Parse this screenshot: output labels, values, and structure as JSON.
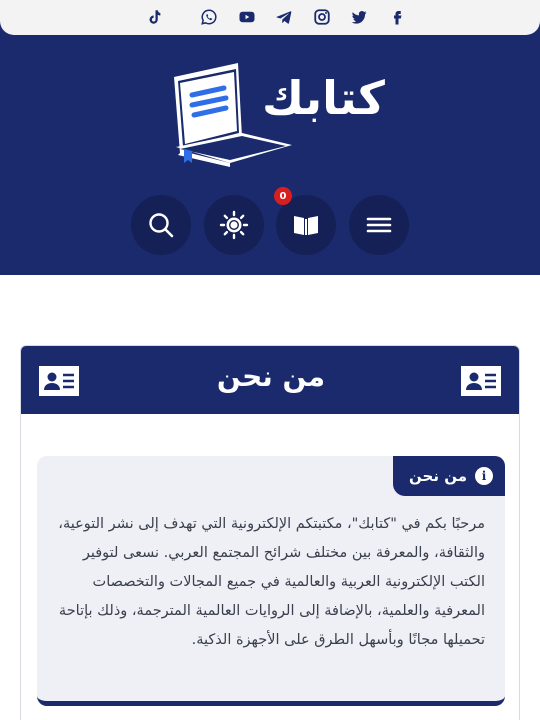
{
  "social": {
    "icons": [
      "facebook-icon",
      "twitter-icon",
      "instagram-icon",
      "telegram-icon",
      "youtube-icon",
      "whatsapp-icon",
      "tiktok-icon"
    ]
  },
  "header": {
    "logo_text": "كتابك",
    "cart_count": "0"
  },
  "page": {
    "title": "من نحن",
    "box_label": "من نحن",
    "info_symbol": "i",
    "body_text": "مرحبًا بكم في \"كتابك\"، مكتبتكم الإلكترونية التي تهدف إلى نشر التوعية، والثقافة، والمعرفة بين مختلف شرائح المجتمع العربي. نسعى لتوفير الكتب الإلكترونية العربية والعالمية في جميع المجالات والتخصصات المعرفية والعلمية، بالإضافة إلى الروايات العالمية المترجمة، وذلك بإتاحة تحميلها مجانًا وبأسهل الطرق على الأجهزة الذكية."
  },
  "colors": {
    "brand": "#1a2a6c",
    "badge": "#d81e1e",
    "topbar": "#f3f3f3",
    "box_bg": "#eef0f5"
  }
}
